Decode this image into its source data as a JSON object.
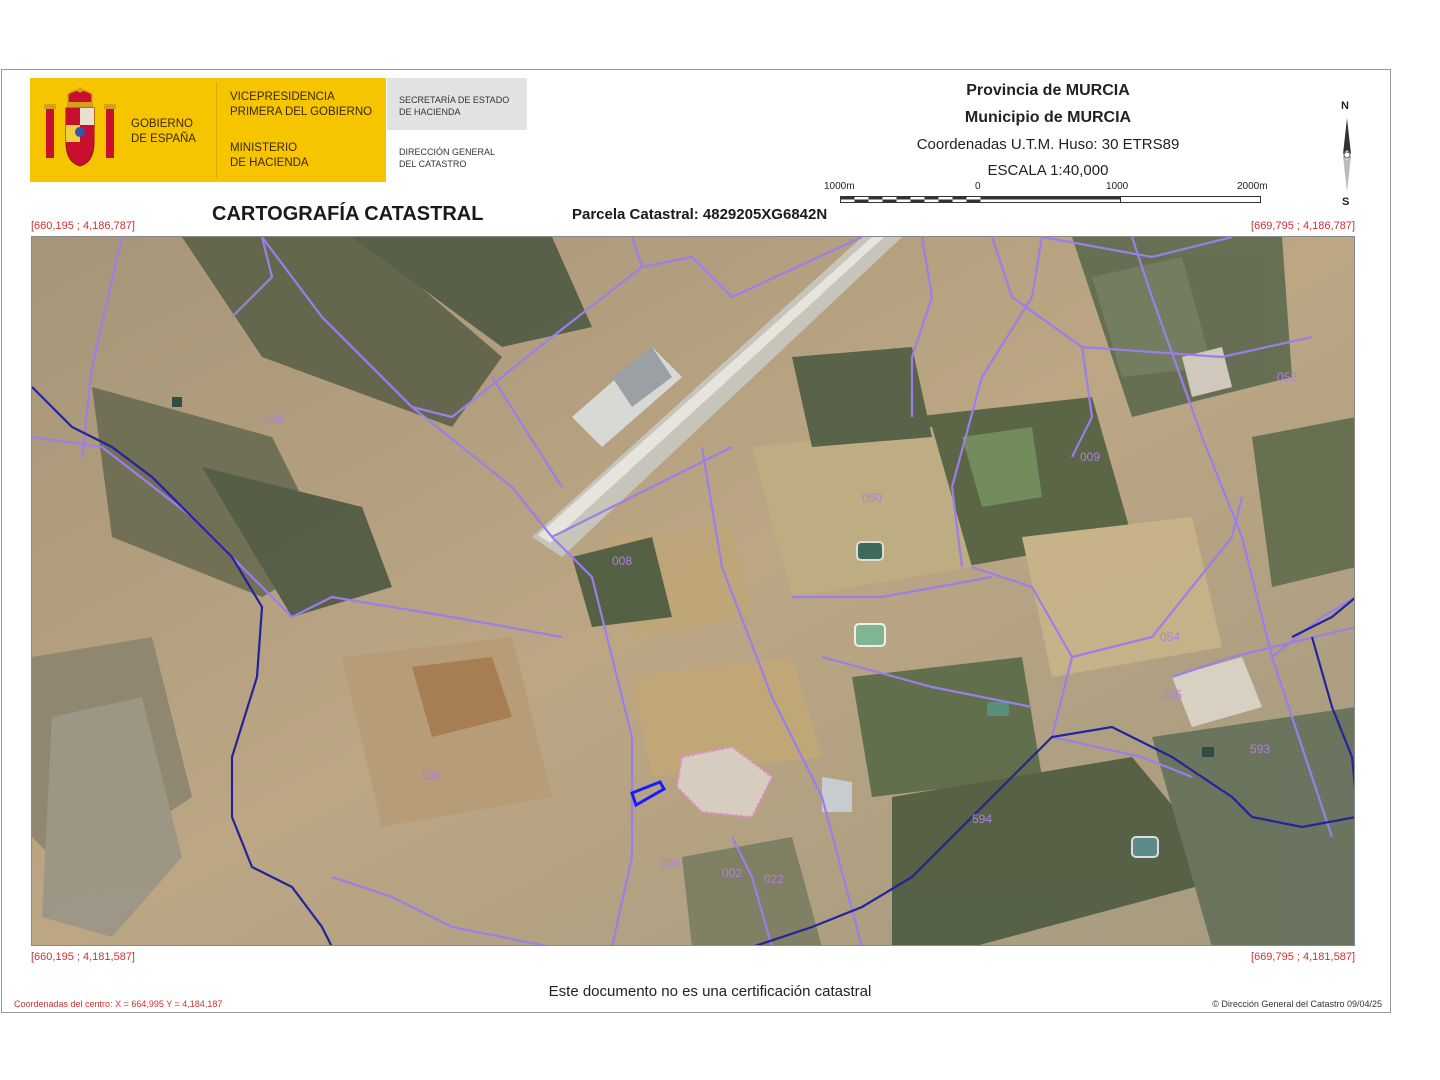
{
  "logo": {
    "gov_line1": "GOBIERNO",
    "gov_line2": "DE ESPAÑA",
    "vice_line1": "VICEPRESIDENCIA",
    "vice_line2": "PRIMERA DEL GOBIERNO",
    "min_line1": "MINISTERIO",
    "min_line2": "DE HACIENDA",
    "sec_line1": "SECRETARÍA DE ESTADO",
    "sec_line2": "DE HACIENDA",
    "dir_line1": "DIRECCIÓN GENERAL",
    "dir_line2": "DEL CATASTRO"
  },
  "header": {
    "province": "Provincia de MURCIA",
    "municipality": "Municipio de MURCIA",
    "coords_system": "Coordenadas U.T.M. Huso: 30 ETRS89",
    "scale": "ESCALA 1:40,000",
    "title": "CARTOGRAFÍA CATASTRAL",
    "parcel": "Parcela Catastral: 4829205XG6842N"
  },
  "compass": {
    "north": "N",
    "south": "S"
  },
  "scalebar": {
    "labels": [
      "1000m",
      "0",
      "1000",
      "2000m"
    ]
  },
  "corners": {
    "top_left": "[660,195 ; 4,186,787]",
    "top_right": "[669,795 ; 4,186,787]",
    "bottom_left": "[660,195 ; 4,181,587]",
    "bottom_right": "[669,795 ; 4,181,587]"
  },
  "map": {
    "polygon_labels": [
      "006",
      "008",
      "050",
      "009",
      "052",
      "054",
      "593",
      "100",
      "003",
      "002",
      "022",
      "005",
      "594"
    ],
    "colors": {
      "boundary": "#9b7fe8",
      "municipal_boundary": "#23249a",
      "parcel": "#1a1aff",
      "urban": "#e58ad0"
    }
  },
  "footer": {
    "disclaimer": "Este documento no es una certificación catastral",
    "center_coords": "Coordenadas del centro: X = 664,995 Y = 4,184,187",
    "copyright": "© Dirección General del Catastro 09/04/25"
  }
}
